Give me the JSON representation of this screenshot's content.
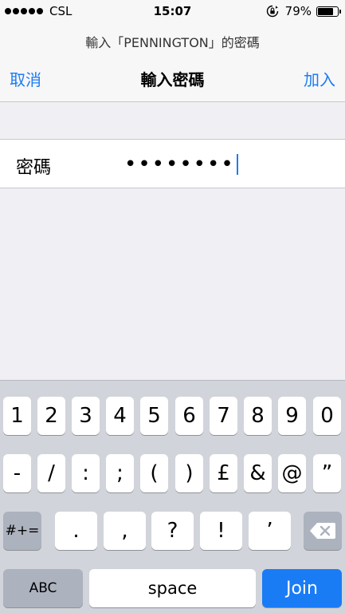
{
  "status_bar": {
    "carrier": "CSL",
    "time": "15:07",
    "battery_percent": "79%",
    "battery_level": 0.79,
    "signal_dots": 5
  },
  "prompt": "輸入「PENNINGTON」的密碼",
  "nav": {
    "cancel_label": "取消",
    "title": "輸入密碼",
    "join_label": "加入"
  },
  "password": {
    "label": "密碼",
    "value": "••••••••"
  },
  "keyboard": {
    "row1": [
      "1",
      "2",
      "3",
      "4",
      "5",
      "6",
      "7",
      "8",
      "9",
      "0"
    ],
    "row2": [
      "-",
      "/",
      ":",
      ";",
      "(",
      ")",
      "£",
      "&",
      "@",
      "”"
    ],
    "row3_left": "#+=",
    "row3": [
      ".",
      ",",
      "?",
      "!",
      "’"
    ],
    "row4_left": "ABC",
    "space": "space",
    "join": "Join"
  },
  "colors": {
    "accent": "#1a7cf5",
    "keyboard_bg": "#d1d4da",
    "dark_key": "#acb2be"
  },
  "icons": {
    "backspace": "backspace-icon",
    "rotation_lock": "rotation-lock-icon",
    "battery": "battery-icon"
  }
}
